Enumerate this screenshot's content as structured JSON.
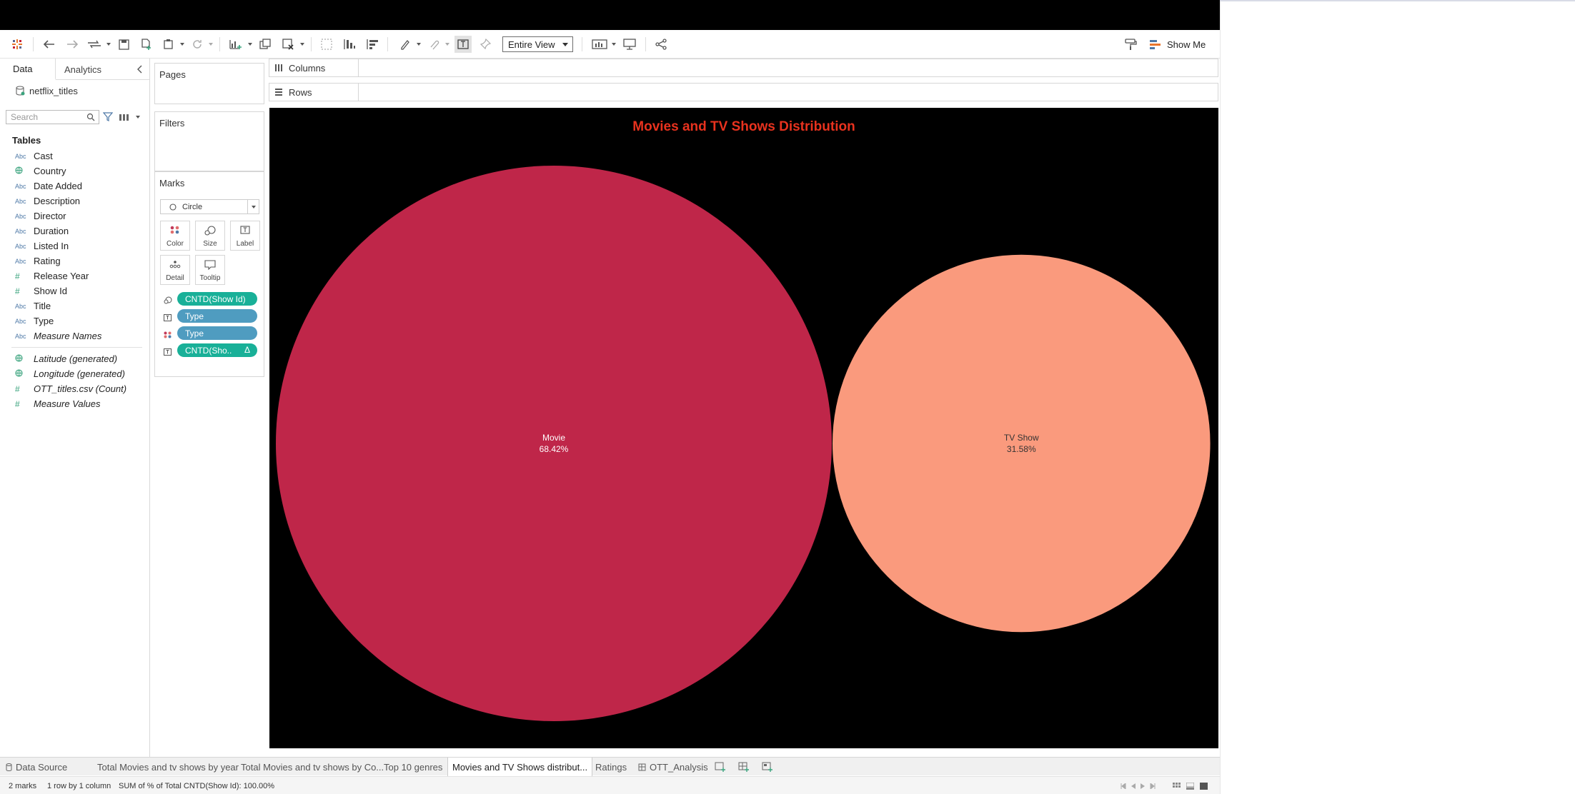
{
  "toolbar": {
    "fit": "Entire View",
    "show_me": "Show Me"
  },
  "data_pane": {
    "tabs": [
      "Data",
      "Analytics"
    ],
    "datasource": "netflix_titles",
    "search_placeholder": "Search",
    "tables_heading": "Tables",
    "fields": [
      {
        "type": "Abc",
        "name": "Cast"
      },
      {
        "type": "globe",
        "name": "Country"
      },
      {
        "type": "Abc",
        "name": "Date Added"
      },
      {
        "type": "Abc",
        "name": "Description"
      },
      {
        "type": "Abc",
        "name": "Director"
      },
      {
        "type": "Abc",
        "name": "Duration"
      },
      {
        "type": "Abc",
        "name": "Listed In"
      },
      {
        "type": "Abc",
        "name": "Rating"
      },
      {
        "type": "#",
        "name": "Release Year"
      },
      {
        "type": "#",
        "name": "Show Id"
      },
      {
        "type": "Abc",
        "name": "Title"
      },
      {
        "type": "Abc",
        "name": "Type"
      },
      {
        "type": "Abc",
        "name": "Measure Names"
      }
    ],
    "generated_fields": [
      {
        "type": "globe",
        "name": "Latitude (generated)"
      },
      {
        "type": "globe",
        "name": "Longitude (generated)"
      },
      {
        "type": "#",
        "name": "OTT_titles.csv (Count)"
      },
      {
        "type": "#",
        "name": "Measure Values"
      }
    ]
  },
  "cards": {
    "pages": "Pages",
    "filters": "Filters",
    "marks": "Marks",
    "mark_type": "Circle",
    "mark_buttons": [
      "Color",
      "Size",
      "Label",
      "Detail",
      "Tooltip"
    ],
    "pills": [
      {
        "label": "CNTD(Show Id)",
        "kind": "green",
        "icon": "size"
      },
      {
        "label": "Type",
        "kind": "blue",
        "icon": "label"
      },
      {
        "label": "Type",
        "kind": "blue",
        "icon": "color"
      },
      {
        "label": "CNTD(Sho..",
        "kind": "green",
        "icon": "label",
        "delta": "Δ"
      }
    ]
  },
  "shelves": {
    "columns": "Columns",
    "rows": "Rows"
  },
  "chart_data": {
    "type": "bubble",
    "title": "Movies and TV Shows Distribution",
    "title_color": "#e8321e",
    "background": "#000000",
    "series": [
      {
        "name": "Movie",
        "value": 68.42,
        "label": "68.42%",
        "color": "#bf2649",
        "text_color": "#ffffff"
      },
      {
        "name": "TV Show",
        "value": 31.58,
        "label": "31.58%",
        "color": "#fa9a7d",
        "text_color": "#333333"
      }
    ]
  },
  "sheets": {
    "data_source": "Data Source",
    "tabs": [
      {
        "label": "Total Movies and tv shows by year"
      },
      {
        "label": "Total Movies and tv shows by Co..."
      },
      {
        "label": "Top 10 genres"
      },
      {
        "label": "Movies and TV Shows distribut...",
        "active": true
      },
      {
        "label": "Ratings"
      },
      {
        "label": "OTT_Analysis"
      }
    ]
  },
  "status": {
    "marks": "2 marks",
    "dims": "1 row by 1 column",
    "sum": "SUM of % of Total CNTD(Show Id): 100.00%"
  }
}
